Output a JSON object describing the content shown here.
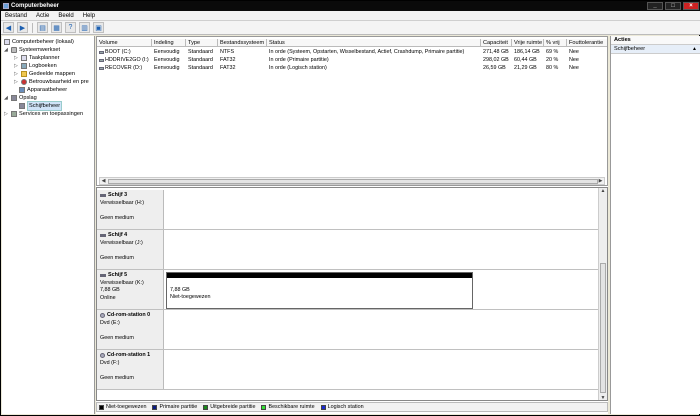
{
  "window": {
    "title": "Computerbeheer"
  },
  "menu": [
    "Bestand",
    "Actie",
    "Beeld",
    "Help"
  ],
  "tree": {
    "root": "Computerbeheer (lokaal)",
    "systemtools": "Systeemwerkset",
    "taakplanner": "Taakplanner",
    "logboeken": "Logboeken",
    "gedeeld": "Gedeelde mappen",
    "betrouwbaarheid": "Betrouwbaarheid en pre",
    "apparaat": "Apparaatbeheer",
    "opslag": "Opslag",
    "schijfbeheer": "Schijfbeheer",
    "services": "Services en toepassingen"
  },
  "table": {
    "columns": [
      "Volume",
      "Indeling",
      "Type",
      "Bestandssysteem",
      "Status",
      "Capaciteit",
      "Vrije ruimte",
      "% vrij",
      "Fouttolerantie"
    ],
    "rows": [
      [
        "BOOT (C:)",
        "Eenvoudig",
        "Standaard",
        "NTFS",
        "In orde (Systeem, Opstarten, Wisselbestand, Actief, Crashdump, Primaire partitie)",
        "271,48 GB",
        "186,14 GB",
        "69 %",
        "Nee"
      ],
      [
        "HDDRIVE2GO (I:)",
        "Eenvoudig",
        "Standaard",
        "FAT32",
        "In orde (Primaire partitie)",
        "298,02 GB",
        "60,44 GB",
        "20 %",
        "Nee"
      ],
      [
        "RECOVER (D:)",
        "Eenvoudig",
        "Standaard",
        "FAT32",
        "In orde (Logisch station)",
        "26,59 GB",
        "21,29 GB",
        "80 %",
        "Nee"
      ]
    ]
  },
  "disks": [
    {
      "name": "Schijf 3",
      "line2": "Verwisselbaar (H:)",
      "line3": "",
      "line4": "Geen medium",
      "icon": "disk-icon"
    },
    {
      "name": "Schijf 4",
      "line2": "Verwisselbaar (J:)",
      "line3": "",
      "line4": "Geen medium",
      "icon": "disk-icon"
    },
    {
      "name": "Schijf 5",
      "line2": "Verwisselbaar (K:)",
      "line3": "7,88 GB",
      "line4": "Online",
      "icon": "disk-icon",
      "partition": {
        "size": "7,88 GB",
        "status": "Niet-toegewezen"
      }
    },
    {
      "name": "Cd-rom-station 0",
      "line2": "Dvd (E:)",
      "line3": "",
      "line4": "Geen medium",
      "icon": "cd-icon"
    },
    {
      "name": "Cd-rom-station 1",
      "line2": "Dvd (F:)",
      "line3": "",
      "line4": "Geen medium",
      "icon": "cd-icon"
    }
  ],
  "legend": [
    {
      "label": "Niet-toegewezen",
      "color": "#000000"
    },
    {
      "label": "Primaire partitie",
      "color": "#0a1a80"
    },
    {
      "label": "Uitgebreide partitie",
      "color": "#1a8a1a"
    },
    {
      "label": "Beschikbare ruimte",
      "color": "#33dd33"
    },
    {
      "label": "Logisch station",
      "color": "#1a2ad0"
    }
  ],
  "actions": {
    "header": "Acties",
    "subheader": "Schijfbeheer"
  }
}
